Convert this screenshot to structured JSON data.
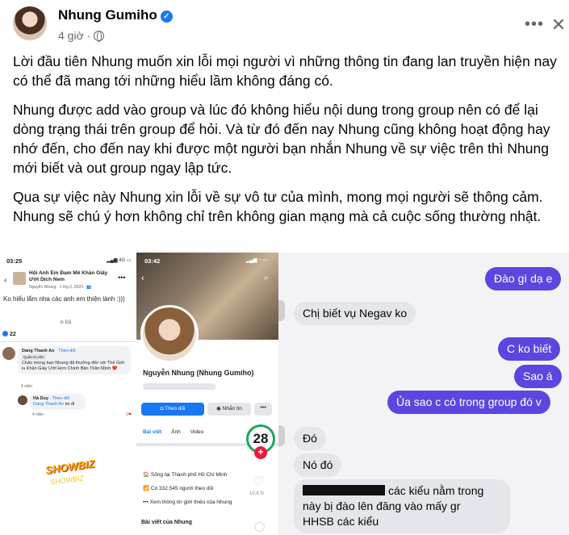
{
  "post": {
    "author": "Nhung Gumiho",
    "verified_icon": "check-badge-icon",
    "time": "4 giờ",
    "separator": "·",
    "privacy_icon": "globe-icon",
    "more_label": "•••",
    "close_label": "✕",
    "paragraphs": [
      "Lời đầu tiên Nhung muốn xin lỗi mọi người vì những thông tin đang lan truyền hiện nay có thể đã mang tới những hiểu lầm không đáng có.",
      "Nhung được add vào group và lúc đó không hiểu nội dung trong group nên có để lại dòng trạng thái trên group để hỏi. Và từ đó đến nay Nhung cũng không hoạt động hay nhớ đến, cho đến nay khi được một người bạn nhắn Nhung về sự việc trên thì Nhung mới biết và out group ngay lập tức.",
      "Qua sự việc này Nhung xin lỗi về sự vô tư của mình, mong mọi người sẽ thông cảm. Nhung sẽ chú ý hơn không chỉ trên không gian mạng mà cả cuộc sống thường nhật."
    ]
  },
  "screenshot_group": {
    "time": "03:25",
    "status_right": "▂▄▆ 4G ▭",
    "back": "‹",
    "group_name": "Hội Anh Em Đam Mê Khăn Giấy Ướt Dịch Nem",
    "group_meta": "Nguyễn Nhung · 1 thg 2, 2020 · 👥",
    "dots": "•••",
    "status_text": "Ko hiểu lắm nha các anh em thiện lành :)))",
    "edit_label": "⊖ Đã",
    "reaction_count": "22",
    "comment1_name": "Dang Thanh An",
    "comment1_follow": "· Theo dõi",
    "comment1_tag": "Quản trị viên",
    "comment1_text": "Chào mừng bạn Nhung đã thưởng đến với Thế Giới lu Khăn Giấy Ướt Hơn Chính Bản Thân Mình ❤️",
    "comment1_time": "4 năm",
    "comment2_name": "Hà Duy",
    "comment2_follow": "· Theo dõi",
    "comment2_mention": "Dang Thanh An",
    "comment2_text": "im đi",
    "comment2_time": "4 năm",
    "comment_react": "1❤",
    "logo_text": "SHOWBIZ",
    "logo_sub": "SHOWBIZ"
  },
  "screenshot_profile": {
    "time": "03:42",
    "status_right": "▂▄▆ ◔ ▭",
    "back": "‹",
    "search": "⌕",
    "name": "Nguyễn Nhung (Nhung Gumiho)",
    "follow_label": "◘ Theo dõi",
    "message_label": "◉ Nhắn tin",
    "more_label": "•••",
    "tabs": [
      "Bài viết",
      "Ảnh",
      "Video"
    ],
    "info_location": "🏠 Sống tại Thành phố Hồ Chí Minh",
    "info_followers": "📶 Có 332.545 người theo dõi",
    "info_more": "••• Xem thông tin giới thiệu của Nhung",
    "posts_heading": "Bài viết của Nhung",
    "badge": "28",
    "badge_plus": "+",
    "heart_icon": "♡",
    "heart_count": "10,8 N",
    "comment_icon": "◯"
  },
  "chat": {
    "messages": [
      {
        "dir": "out",
        "text": "Đào gì dạ e"
      },
      {
        "dir": "in",
        "text": "Chị biết vụ Negav ko"
      },
      {
        "dir": "out",
        "text": "C ko biết"
      },
      {
        "dir": "out",
        "text": "Sao á"
      },
      {
        "dir": "out",
        "text": "Ủa sao c có trong group đó v"
      },
      {
        "dir": "in",
        "text": "Đó"
      },
      {
        "dir": "in",
        "text": "Nó đó"
      },
      {
        "dir": "in",
        "line1": "các kiểu nằm trong",
        "line2": "này bị đào lên đăng vào mấy gr",
        "line3": "HHSB các kiểu"
      }
    ]
  }
}
